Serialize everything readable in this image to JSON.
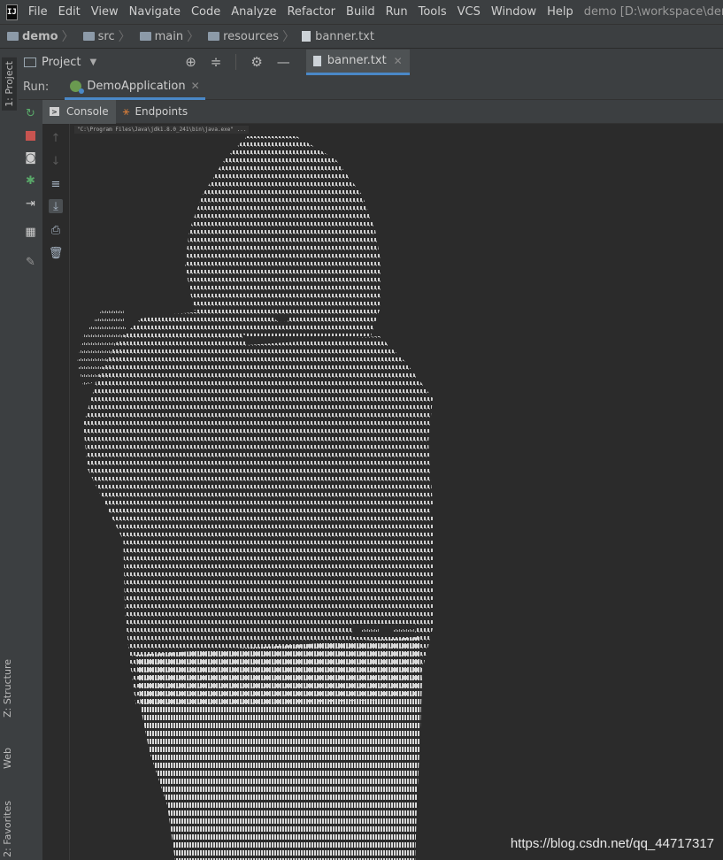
{
  "menu": {
    "items": [
      "File",
      "Edit",
      "View",
      "Navigate",
      "Code",
      "Analyze",
      "Refactor",
      "Build",
      "Run",
      "Tools",
      "VCS",
      "Window",
      "Help"
    ],
    "title": "demo [D:\\workspace\\demo] - ..."
  },
  "breadcrumb": {
    "items": [
      "demo",
      "src",
      "main",
      "resources",
      "banner.txt"
    ]
  },
  "side": {
    "project": "1: Project",
    "structure": "Z: Structure",
    "web": "Web",
    "favorites": "2: Favorites"
  },
  "toolbar": {
    "project_label": "Project",
    "open_tab": "banner.txt"
  },
  "run": {
    "label": "Run:",
    "config": "DemoApplication"
  },
  "subtabs": {
    "console": "Console",
    "endpoints": "Endpoints"
  },
  "console": {
    "command": "\"C:\\Program Files\\Java\\jdk1.8.0_241\\bin\\java.exe\" ..."
  },
  "watermark": "https://blog.csdn.net/qq_44717317",
  "colors": {
    "background": "#2b2b2b",
    "panel": "#3c3f41",
    "accent": "#4a88c7",
    "banner_text": "#d8d8d8"
  }
}
